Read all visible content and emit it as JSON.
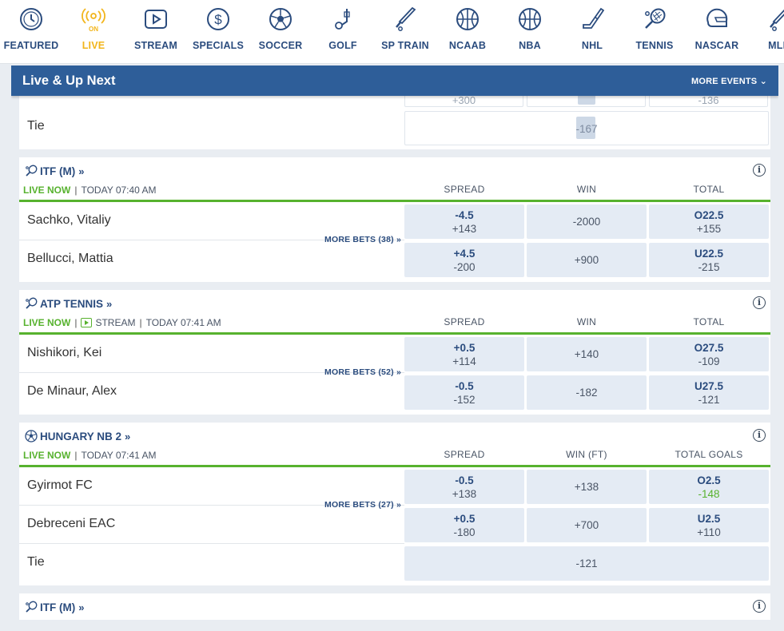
{
  "nav": {
    "items": [
      {
        "label": "FEATURED",
        "icon": "clock-icon",
        "active": false
      },
      {
        "label": "LIVE",
        "icon": "live-on-icon",
        "active": true
      },
      {
        "label": "STREAM",
        "icon": "play-icon",
        "active": false
      },
      {
        "label": "SPECIALS",
        "icon": "dollar-icon",
        "active": false
      },
      {
        "label": "SOCCER",
        "icon": "soccer-ball-icon",
        "active": false
      },
      {
        "label": "GOLF",
        "icon": "golf-icon",
        "active": false
      },
      {
        "label": "SP TRAIN",
        "icon": "baseball-bat-icon",
        "active": false
      },
      {
        "label": "NCAAB",
        "icon": "basketball-icon",
        "active": false
      },
      {
        "label": "NBA",
        "icon": "basketball-icon",
        "active": false
      },
      {
        "label": "NHL",
        "icon": "hockey-stick-icon",
        "active": false
      },
      {
        "label": "TENNIS",
        "icon": "tennis-racket-icon",
        "active": false
      },
      {
        "label": "NASCAR",
        "icon": "helmet-icon",
        "active": false
      },
      {
        "label": "MLB",
        "icon": "baseball-bat-icon",
        "active": false
      }
    ]
  },
  "header": {
    "title": "Live & Up Next",
    "more_events": "MORE EVENTS"
  },
  "top_partial": {
    "row1_odds": [
      "+300",
      "-136"
    ],
    "tie_label": "Tie",
    "tie_odds": "-167"
  },
  "events": [
    {
      "league": "ITF (M)",
      "status_live": "LIVE NOW",
      "stream": "",
      "time": "TODAY 07:40 AM",
      "cols": [
        "SPREAD",
        "WIN",
        "TOTAL"
      ],
      "more_bets": "MORE BETS (38)",
      "rows": [
        {
          "team": "Sachko, Vitaliy",
          "spread": [
            "-4.5",
            "+143"
          ],
          "win": "-2000",
          "total": [
            "O22.5",
            "+155"
          ]
        },
        {
          "team": "Bellucci, Mattia",
          "spread": [
            "+4.5",
            "-200"
          ],
          "win": "+900",
          "total": [
            "U22.5",
            "-215"
          ]
        }
      ]
    },
    {
      "league": "ATP TENNIS",
      "status_live": "LIVE NOW",
      "stream": "STREAM",
      "time": "TODAY 07:41 AM",
      "cols": [
        "SPREAD",
        "WIN",
        "TOTAL"
      ],
      "more_bets": "MORE BETS (52)",
      "rows": [
        {
          "team": "Nishikori, Kei",
          "spread": [
            "+0.5",
            "+114"
          ],
          "win": "+140",
          "total": [
            "O27.5",
            "-109"
          ]
        },
        {
          "team": "De Minaur, Alex",
          "spread": [
            "-0.5",
            "-152"
          ],
          "win": "-182",
          "total": [
            "U27.5",
            "-121"
          ]
        }
      ]
    },
    {
      "league": "HUNGARY NB 2",
      "status_live": "LIVE NOW",
      "stream": "",
      "time": "TODAY 07:41 AM",
      "cols": [
        "SPREAD",
        "WIN (FT)",
        "TOTAL GOALS"
      ],
      "more_bets": "MORE BETS (27)",
      "rows": [
        {
          "team": "Gyirmot FC",
          "spread": [
            "-0.5",
            "+138"
          ],
          "win": "+138",
          "total": [
            "O2.5",
            "-148"
          ]
        },
        {
          "team": "Debreceni EAC",
          "spread": [
            "+0.5",
            "-180"
          ],
          "win": "+700",
          "total": [
            "U2.5",
            "+110"
          ]
        }
      ],
      "tie": {
        "label": "Tie",
        "odds": "-121"
      }
    },
    {
      "league": "ITF (M)"
    }
  ],
  "colors": {
    "accent": "#2e5e99",
    "live": "#57b22e",
    "active_nav": "#f2b51b",
    "odds_bg": "#e4ebf4"
  }
}
